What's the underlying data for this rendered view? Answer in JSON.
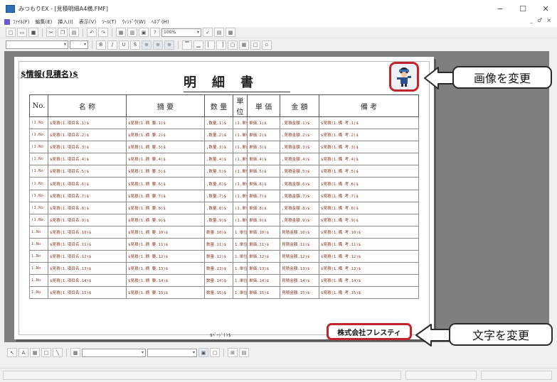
{
  "window": {
    "title": "みつもりEX - [見積明細A4横.FMF]",
    "controls": [
      "−",
      "☐",
      "✕"
    ]
  },
  "menubar": {
    "items": [
      "ﾌｧｲﾙ(F)",
      "編集(E)",
      "挿入(I)",
      "表示(V)",
      "ﾂｰﾙ(T)",
      "ｳｨﾝﾄﾞｳ(W)",
      "ﾍﾙﾌﾟ(H)"
    ],
    "mdi_controls": [
      "_",
      "♂",
      "×"
    ]
  },
  "toolbar": {
    "zoom": "100%"
  },
  "report": {
    "info_text": "$情報(見積名)$",
    "title": "明細書",
    "columns": [
      "No.",
      "名 称",
      "摘 要",
      "数 量",
      "単位",
      "単 価",
      "金 額",
      "備 考"
    ],
    "rows": [
      [
        "(1.No",
        "$見積(1.項目名.1)$",
        "$見積(1.摘 要.1)$",
        ",数量.1)$",
        "(1.単位",
        "単価.1)$",
        ",見積金額.1)$",
        "$見積(1.備 考.1)$"
      ],
      [
        "(1.No",
        "$見積(1.項目名.2)$",
        "$見積(1.摘 要.2)$",
        ",数量.2)$",
        "(1.単位",
        "単価.2)$",
        ",見積金額.2)$",
        "$見積(1.備 考.2)$"
      ],
      [
        "(1.No",
        "$見積(1.項目名.3)$",
        "$見積(1.摘 要.3)$",
        ",数量.3)$",
        "(1.単位",
        "単価.3)$",
        ",見積金額.3)$",
        "$見積(1.備 考.3)$"
      ],
      [
        "(1.No",
        "$見積(1.項目名.4)$",
        "$見積(1.摘 要.4)$",
        ",数量.4)$",
        "(1.単位",
        "単価.4)$",
        ",見積金額.4)$",
        "$見積(1.備 考.4)$"
      ],
      [
        "(1.No",
        "$見積(1.項目名.5)$",
        "$見積(1.摘 要.5)$",
        ",数量.5)$",
        "(1.単位",
        "単価.5)$",
        ",見積金額.5)$",
        "$見積(1.備 考.5)$"
      ],
      [
        "(1.No",
        "$見積(1.項目名.6)$",
        "$見積(1.摘 要.6)$",
        ",数量.6)$",
        "(1.単位",
        "単価.6)$",
        ",見積金額.6)$",
        "$見積(1.備 考.6)$"
      ],
      [
        "(1.No",
        "$見積(1.項目名.7)$",
        "$見積(1.摘 要.7)$",
        ",数量.7)$",
        "(1.単位",
        "単価.7)$",
        ",見積金額.7)$",
        "$見積(1.備 考.7)$"
      ],
      [
        "(1.No",
        "$見積(1.項目名.8)$",
        "$見積(1.摘 要.8)$",
        ",数量.8)$",
        "(1.単位",
        "単価.8)$",
        ",見積金額.8)$",
        "$見積(1.備 考.8)$"
      ],
      [
        "(1.No",
        "$見積(1.項目名.9)$",
        "$見積(1.摘 要.9)$",
        ",数量.9)$",
        "(1.単位",
        "単価.9)$",
        ",見積金額.9)$",
        "$見積(1.備 考.9)$"
      ],
      [
        "1.No",
        "$見積(1.項目名.10)$",
        "$見積(1.摘 要.10)$",
        "数量.10)$",
        "1.単位",
        "単価.10)$",
        "見積金額.10)$",
        "$見積(1.備 考.10)$"
      ],
      [
        "1.No",
        "$見積(1.項目名.11)$",
        "$見積(1.摘 要.11)$",
        "数量.11)$",
        "1.単位",
        "単価.11)$",
        "見積金額.11)$",
        "$見積(1.備 考.11)$"
      ],
      [
        "1.No",
        "$見積(1.項目名.12)$",
        "$見積(1.摘 要.12)$",
        "数量.12)$",
        "1.単位",
        "単価.12)$",
        "見積金額.12)$",
        "$見積(1.備 考.12)$"
      ],
      [
        "1.No",
        "$見積(1.項目名.13)$",
        "$見積(1.摘 要.13)$",
        "数量.13)$",
        "1.単位",
        "単価.13)$",
        "見積金額.13)$",
        "$見積(1.備 考.13)$"
      ],
      [
        "1.No",
        "$見積(1.項目名.14)$",
        "$見積(1.摘 要.14)$",
        "数量.14)$",
        "1.単位",
        "単価.14)$",
        "見積金額.14)$",
        "$見積(1.備 考.14)$"
      ],
      [
        "1.No",
        "$見積(1.項目名.15)$",
        "$見積(1.摘 要.15)$",
        "数量.15)$",
        "1.単位",
        "単価.15)$",
        "見積金額.15)$",
        "$見積(1.備 考.15)$"
      ]
    ],
    "page_code": "$ﾍﾟｰｼﾞ()$",
    "company": "株式会社フレスティ"
  },
  "callouts": {
    "image_change": "画像を変更",
    "text_change": "文字を変更"
  },
  "colors": {
    "highlight_red": "#c2242b",
    "workarea_gray": "#7f7f7f"
  }
}
